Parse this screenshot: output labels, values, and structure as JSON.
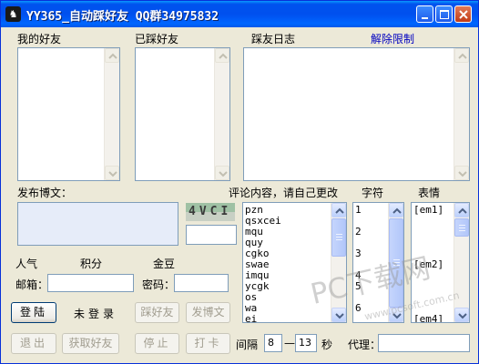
{
  "window": {
    "title": "YY365_自动踩好友 QQ群34975832",
    "title_icon_glyph": "♞"
  },
  "labels": {
    "my_friends": "我的好友",
    "stepped_friends": "已踩好友",
    "step_log": "踩友日志",
    "unlock_limit": "解除限制",
    "post_blog": "发布博文：",
    "comment_content": "评论内容，请自己更改",
    "chars": "字符",
    "emoticons": "表情",
    "popularity": "人气",
    "points": "积分",
    "gold_beans": "金豆",
    "email": "邮箱：",
    "password": "密码：",
    "not_logged_in": "未登录",
    "interval": "间隔",
    "dash": "—",
    "seconds": "秒",
    "proxy": "代理："
  },
  "captcha": {
    "text": "4VCI"
  },
  "comments": [
    "pzn",
    "qsxcei",
    "mqu",
    "quy",
    "cgko",
    "swae",
    "imqu",
    "ycgk",
    "os",
    "wa",
    "ei"
  ],
  "char_numbers": [
    "1",
    "2",
    "3",
    "4",
    "5",
    "6"
  ],
  "emoticon_items": [
    "[em1]",
    "[em2]",
    "[em4]"
  ],
  "buttons": {
    "login": "登陆",
    "step_friends": "踩好友",
    "post_blog": "发博文",
    "logout": "退出",
    "get_friends": "获取好友",
    "stop": "停止",
    "check_in": "打卡"
  },
  "interval": {
    "min": "8",
    "max": "13"
  },
  "watermark": {
    "line1": "PC下载网",
    "line2": "www.pcsoft.com.cn"
  }
}
